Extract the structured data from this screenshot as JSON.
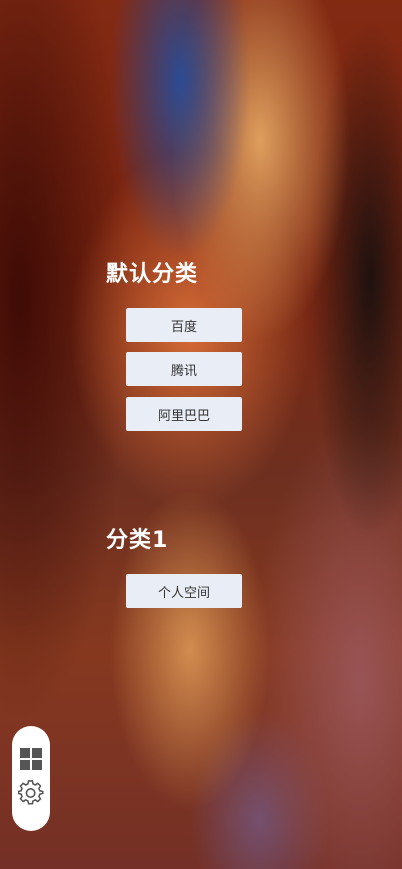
{
  "groups": [
    {
      "title": "默认分类",
      "links": [
        {
          "label": "百度"
        },
        {
          "label": "腾讯"
        },
        {
          "label": "阿里巴巴"
        }
      ]
    },
    {
      "title": "分类1",
      "links": [
        {
          "label": "个人空间"
        }
      ]
    }
  ],
  "dock": {
    "items": [
      {
        "icon": "grid-icon"
      },
      {
        "icon": "gear-icon"
      }
    ]
  },
  "colors": {
    "button_bg": "#e9edf5",
    "button_text": "#333333",
    "title_text": "#ffffff",
    "dock_bg": "#ffffff",
    "icon": "#555555"
  }
}
